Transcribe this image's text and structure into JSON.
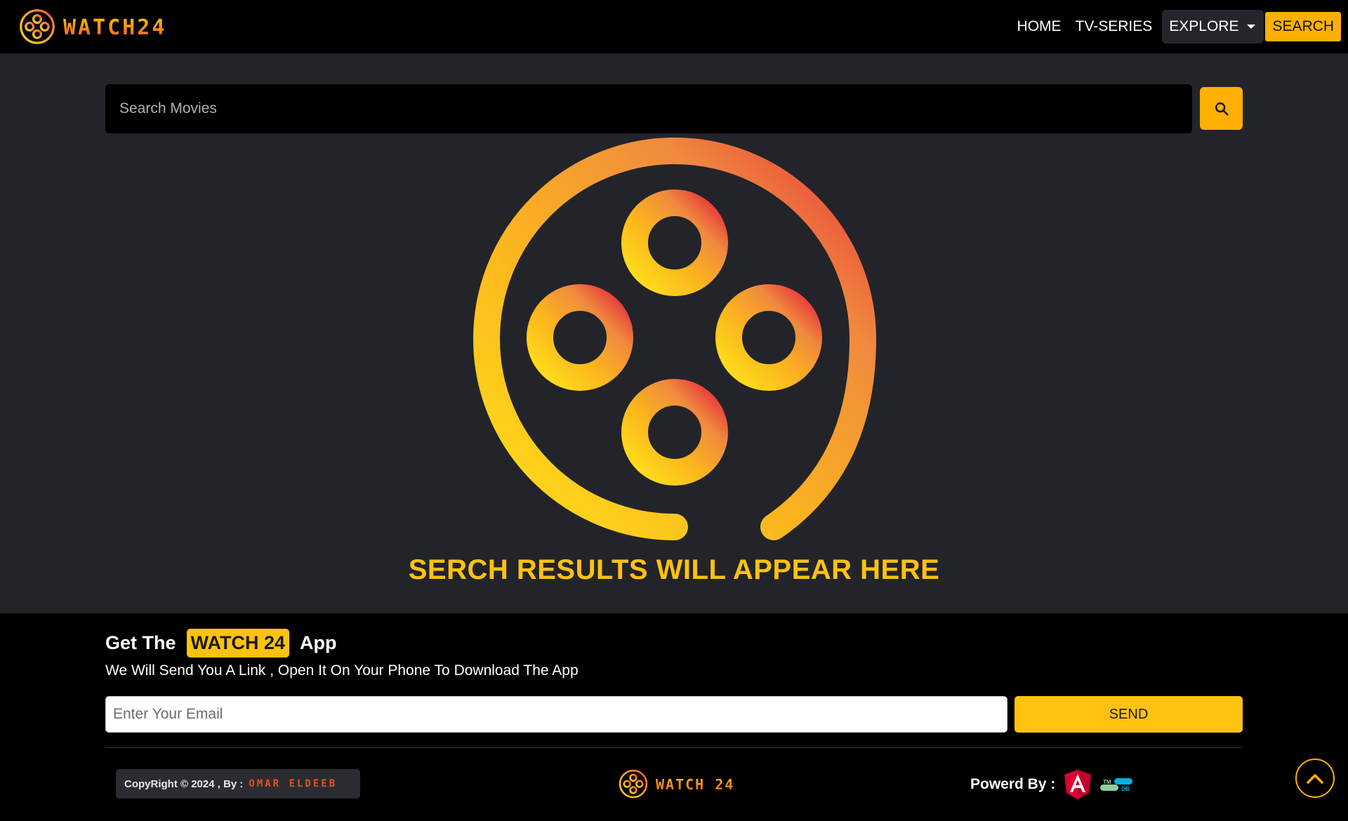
{
  "navbar": {
    "brand": "WATCH24",
    "links": {
      "home": "HOME",
      "tv_series": "TV-SERIES",
      "explore": "EXPLORE",
      "search": "SEARCH"
    },
    "icons": {
      "logo": "film-reel-icon",
      "dropdown": "caret-down-icon"
    }
  },
  "search": {
    "placeholder": "Search Movies",
    "value": "",
    "button_icon": "search-icon"
  },
  "main": {
    "illustration": "film-reel-icon",
    "results_text": "SERCH RESULTS WILL APPEAR HERE"
  },
  "footer": {
    "app": {
      "prefix": "Get The",
      "badge": "WATCH 24",
      "suffix": "App",
      "subtitle": "We Will Send You A Link , Open It On Your Phone To Download The App"
    },
    "email": {
      "placeholder": "Enter Your Email",
      "value": ""
    },
    "send_label": "SEND",
    "copyright": {
      "text": "CopyRight © 2024 , By :",
      "author": "OMAR ELDEEB"
    },
    "brand": "WATCH 24",
    "powered_by": {
      "label": "Powerd By :",
      "logos": [
        "angular-logo-icon",
        "tmdb-logo-icon"
      ]
    },
    "scroll_top_icon": "chevron-up-icon"
  },
  "colors": {
    "accent": "#ffb000",
    "accent_yellow": "#ffc20e",
    "brand_orange": "#f57a1f",
    "brand_red": "#e8452f",
    "navbar_bg": "#000000",
    "main_bg": "#232429"
  }
}
